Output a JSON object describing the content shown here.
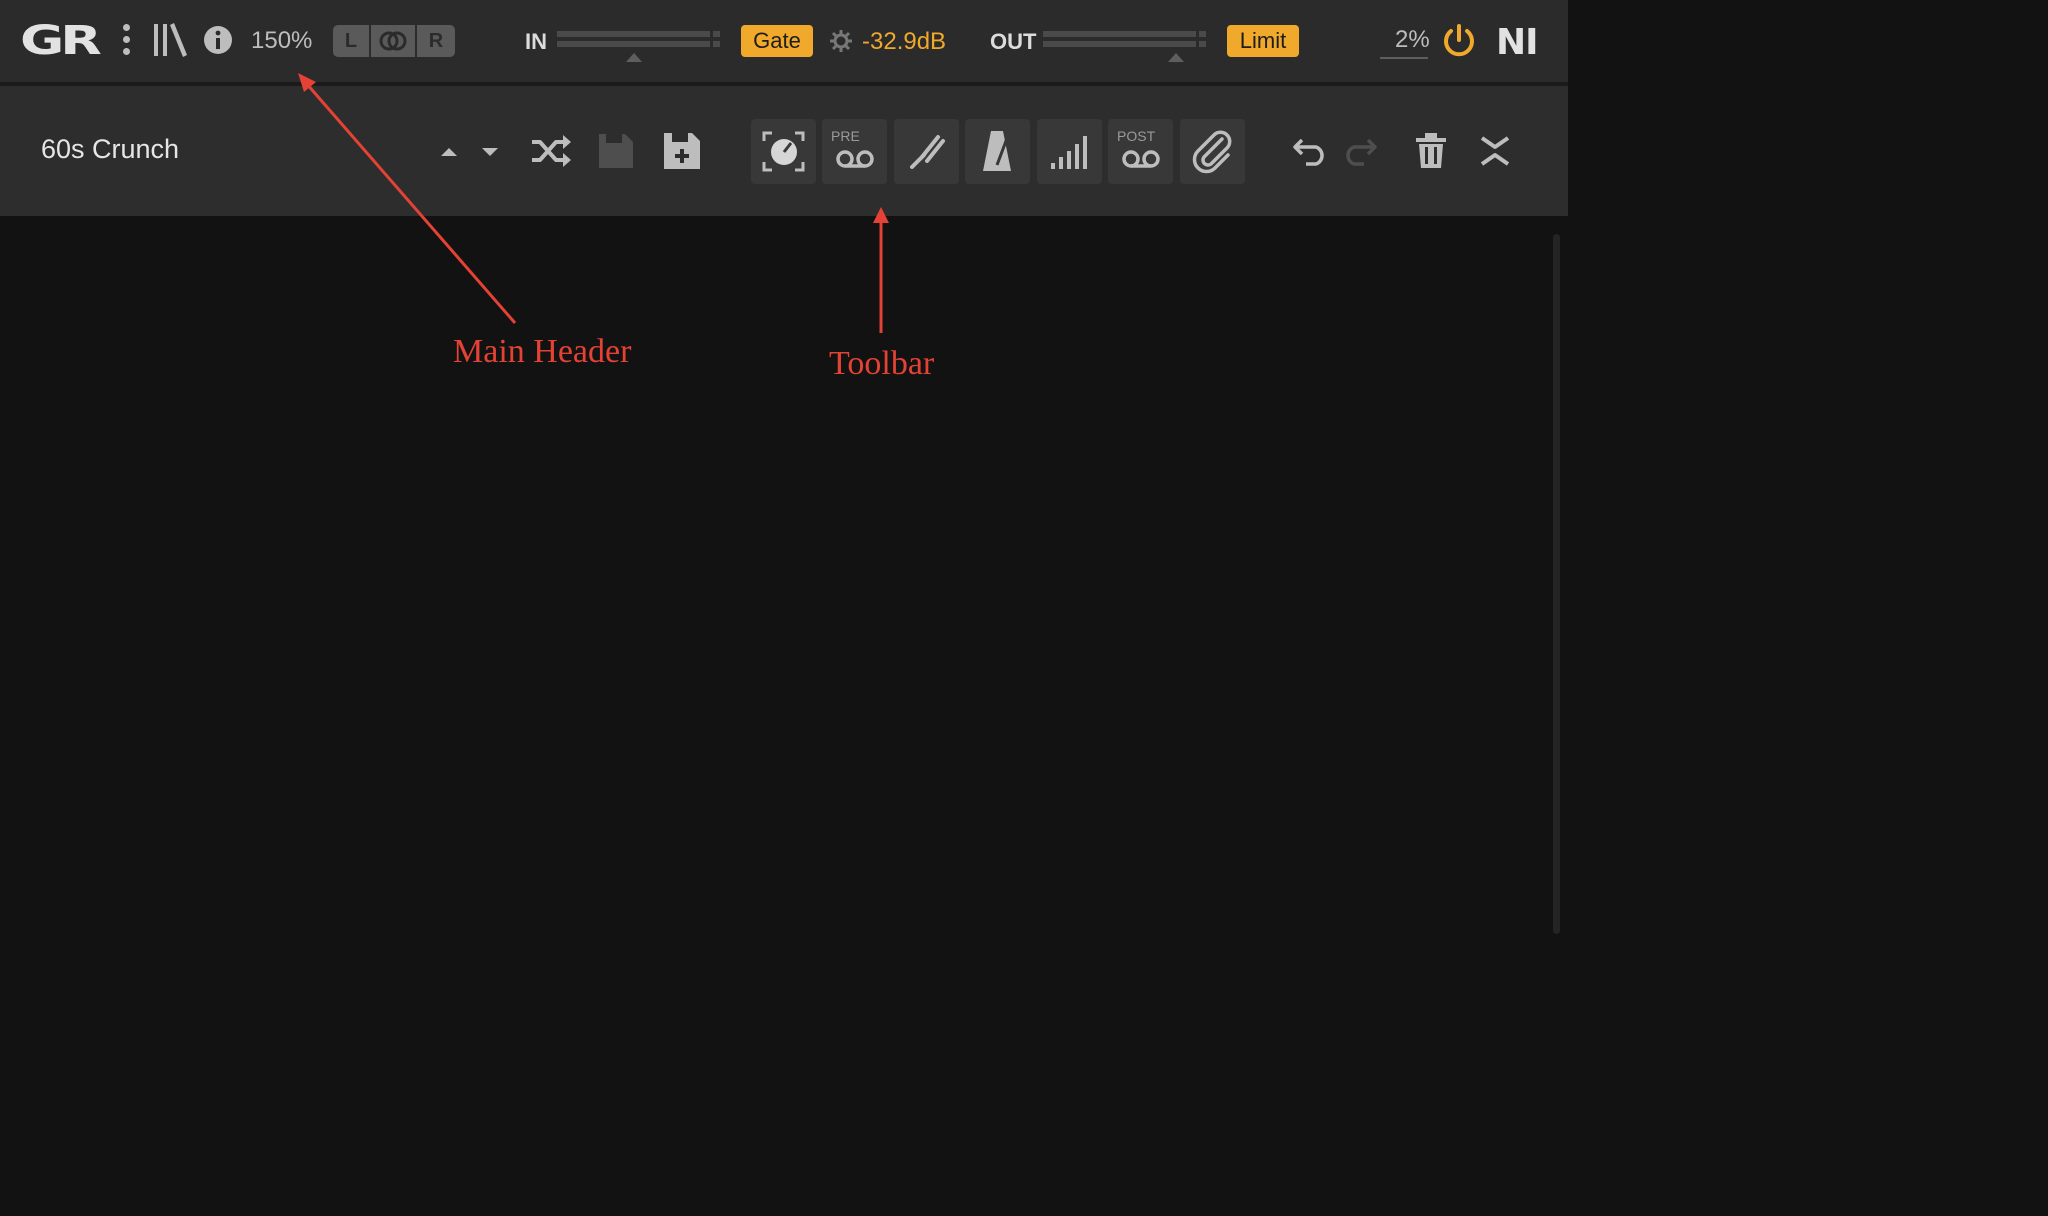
{
  "header": {
    "logo": "GR",
    "zoom": "150%",
    "channels": {
      "left": "L",
      "center": "",
      "right": "R"
    },
    "input_label": "IN",
    "gate_label": "Gate",
    "gate_value": "-32.9dB",
    "output_label": "OUT",
    "limit_label": "Limit",
    "cpu": "2%",
    "brand": "NI"
  },
  "toolbar": {
    "preset_name": "60s Crunch",
    "pre_label": "PRE",
    "post_label": "POST"
  },
  "annotations": {
    "main_header": "Main Header",
    "toolbar": "Toolbar"
  },
  "colors": {
    "accent": "#f0a92a",
    "annotation": "#e34234",
    "header_bg": "#2b2b2b",
    "toolbar_bg": "#2d2d2d",
    "content_bg": "#121212"
  },
  "icons": [
    "menu-icon",
    "library-icon",
    "info-icon",
    "stereo-link-icon",
    "gear-icon",
    "power-icon",
    "preset-up-icon",
    "preset-down-icon",
    "shuffle-icon",
    "save-icon",
    "save-as-icon",
    "camera-view-icon",
    "pre-tape-icon",
    "tuner-icon",
    "metronome-icon",
    "signal-level-icon",
    "post-tape-icon",
    "attachment-icon",
    "undo-icon",
    "redo-icon",
    "trash-icon",
    "collapse-icon"
  ]
}
